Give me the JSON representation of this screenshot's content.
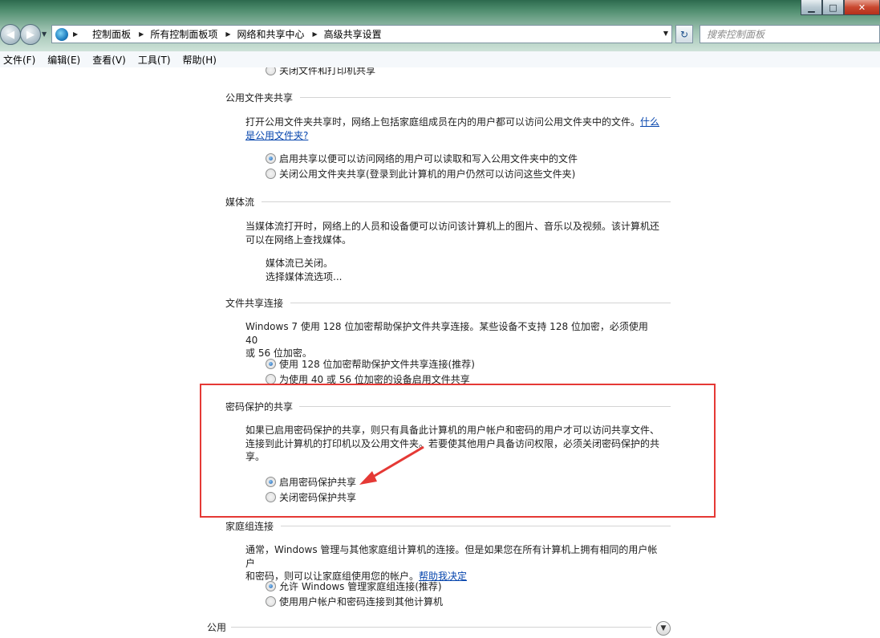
{
  "window": {
    "controls": {
      "minimize": "▁",
      "maximize": "□",
      "close": "✕"
    }
  },
  "address": {
    "crumbs": [
      "控制面板",
      "所有控制面板项",
      "网络和共享中心",
      "高级共享设置"
    ]
  },
  "search": {
    "placeholder": "搜索控制面板"
  },
  "menu": [
    "文件(F)",
    "编辑(E)",
    "查看(V)",
    "工具(T)",
    "帮助(H)"
  ],
  "sections": {
    "top_cut_option": "关闭文件和打印机共享",
    "public_folder": {
      "title": "公用文件夹共享",
      "desc": "打开公用文件夹共享时，网络上包括家庭组成员在内的用户都可以访问公用文件夹中的文件。",
      "link_1": "什么",
      "link_2": "是公用文件夹?",
      "options": [
        "启用共享以便可以访问网络的用户可以读取和写入公用文件夹中的文件",
        "关闭公用文件夹共享(登录到此计算机的用户仍然可以访问这些文件夹)"
      ]
    },
    "media": {
      "title": "媒体流",
      "desc_1": "当媒体流打开时，网络上的人员和设备便可以访问该计算机上的图片、音乐以及视频。该计算机还",
      "desc_2": "可以在网络上查找媒体。",
      "status": "媒体流已关闭。",
      "link": "选择媒体流选项..."
    },
    "file_sharing": {
      "title": "文件共享连接",
      "desc_1": "Windows 7 使用 128 位加密帮助保护文件共享连接。某些设备不支持 128 位加密，必须使用 40",
      "desc_2": "或 56 位加密。",
      "options": [
        "使用 128 位加密帮助保护文件共享连接(推荐)",
        "为使用 40 或 56 位加密的设备启用文件共享"
      ]
    },
    "password": {
      "title": "密码保护的共享",
      "desc_1": "如果已启用密码保护的共享，则只有具备此计算机的用户帐户和密码的用户才可以访问共享文件、",
      "desc_2": "连接到此计算机的打印机以及公用文件夹。若要使其他用户具备访问权限，必须关闭密码保护的共",
      "desc_3": "享。",
      "options": [
        "启用密码保护共享",
        "关闭密码保护共享"
      ]
    },
    "homegroup": {
      "title": "家庭组连接",
      "desc_1": "通常，Windows 管理与其他家庭组计算机的连接。但是如果您在所有计算机上拥有相同的用户帐户",
      "desc_2": "和密码，则可以让家庭组使用您的帐户。",
      "link": "帮助我决定",
      "options": [
        "允许 Windows 管理家庭组连接(推荐)",
        "使用用户帐户和密码连接到其他计算机"
      ]
    },
    "public_profile": {
      "title": "公用"
    }
  },
  "colors": {
    "annotation": "#e53935",
    "link": "#0645ad"
  }
}
